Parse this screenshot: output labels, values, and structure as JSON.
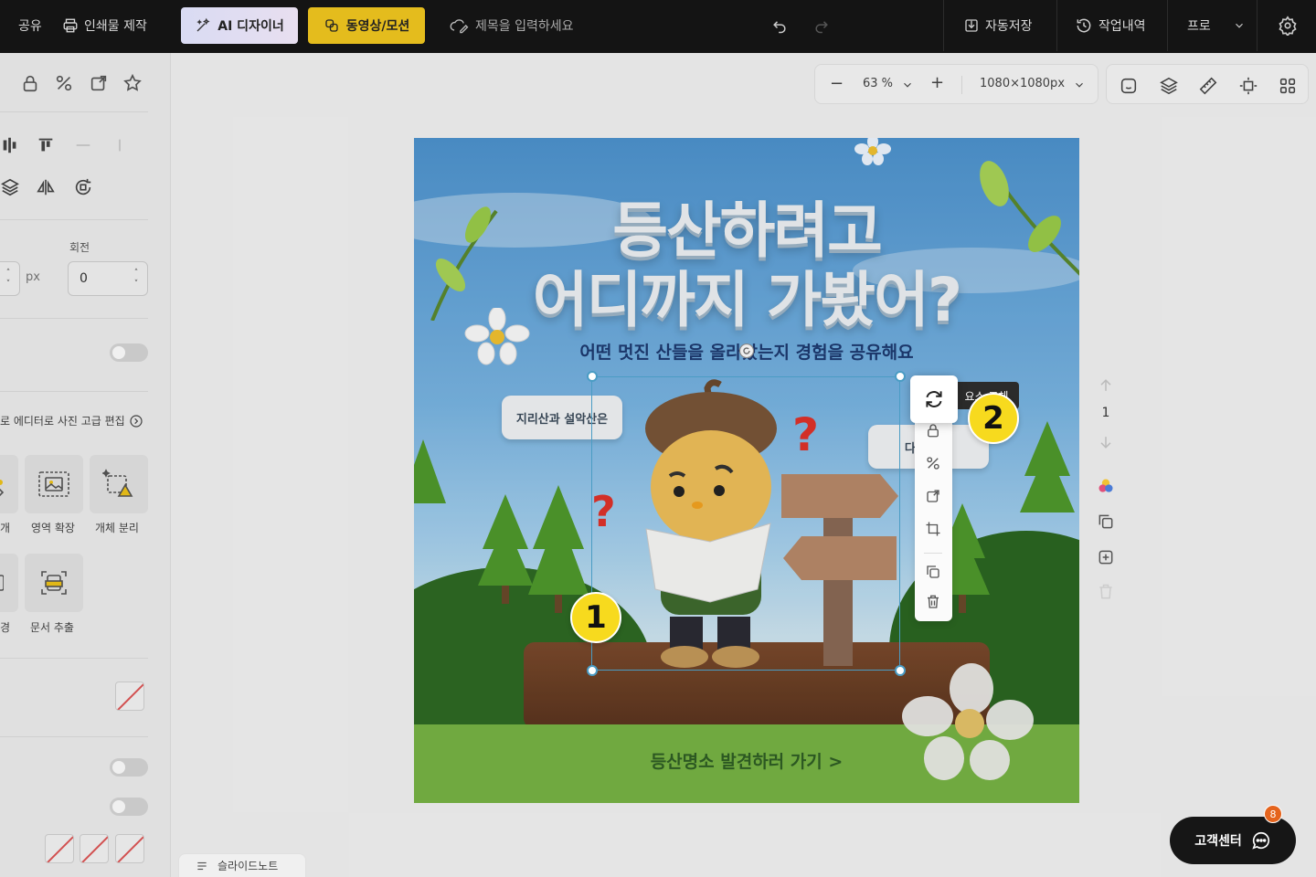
{
  "topbar": {
    "share": "공유",
    "print": "인쇄물 제작",
    "ai_designer": "AI 디자이너",
    "video_motion": "동영상/모션",
    "title_placeholder": "제목을 입력하세요",
    "autosave": "자동저장",
    "history": "작업내역",
    "plan": "프로"
  },
  "sidebar": {
    "rotation_label": "회전",
    "size_unit": "px",
    "rotation_value": "0",
    "photo_edit_link": "로 에디터로 사진 고급 편집",
    "tools": [
      {
        "label": "개"
      },
      {
        "label": "영역 확장"
      },
      {
        "label": "개체 분리"
      },
      {
        "label": "경"
      },
      {
        "label": "문서 추출"
      }
    ]
  },
  "canvas_toolbar": {
    "zoom": "63 %",
    "canvas_size": "1080×1080px"
  },
  "artboard": {
    "headline_line1": "등산하려고",
    "headline_line2": "어디까지 가봤어?",
    "subline": "어떤 멋진 산들을 올라갔는지 경험을 공유해요",
    "bubble_left": "지리산과 설악산은",
    "bubble_right": "다른 친구",
    "cta": "등산명소 발견하러 가기  >",
    "question_mark": "?"
  },
  "selection": {
    "tooltip": "요소 교체"
  },
  "annotations": {
    "badge1": "1",
    "badge2": "2"
  },
  "page_nav": {
    "current_page": "1"
  },
  "support": {
    "label": "고객센터",
    "count": "8"
  },
  "notes": {
    "label": "슬라이드노트"
  }
}
